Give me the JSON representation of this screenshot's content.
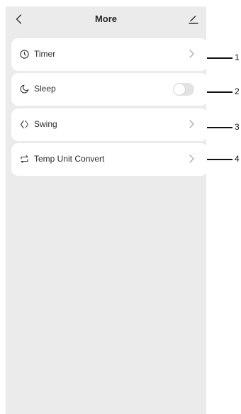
{
  "header": {
    "title": "More",
    "back_icon": "chevron-left-icon",
    "edit_icon": "edit-icon"
  },
  "items": [
    {
      "label": "Timer",
      "icon": "clock-icon",
      "control": "chevron"
    },
    {
      "label": "Sleep",
      "icon": "moon-icon",
      "control": "toggle",
      "toggle_on": false
    },
    {
      "label": "Swing",
      "icon": "swing-icon",
      "control": "chevron"
    },
    {
      "label": "Temp Unit Convert",
      "icon": "convert-icon",
      "control": "chevron"
    }
  ],
  "callouts": [
    "1",
    "2",
    "3",
    "4"
  ],
  "colors": {
    "page_bg": "#ebebeb",
    "card_bg": "#ffffff",
    "text": "#2c2c2c",
    "toggle_off": "#e3e3e3"
  }
}
